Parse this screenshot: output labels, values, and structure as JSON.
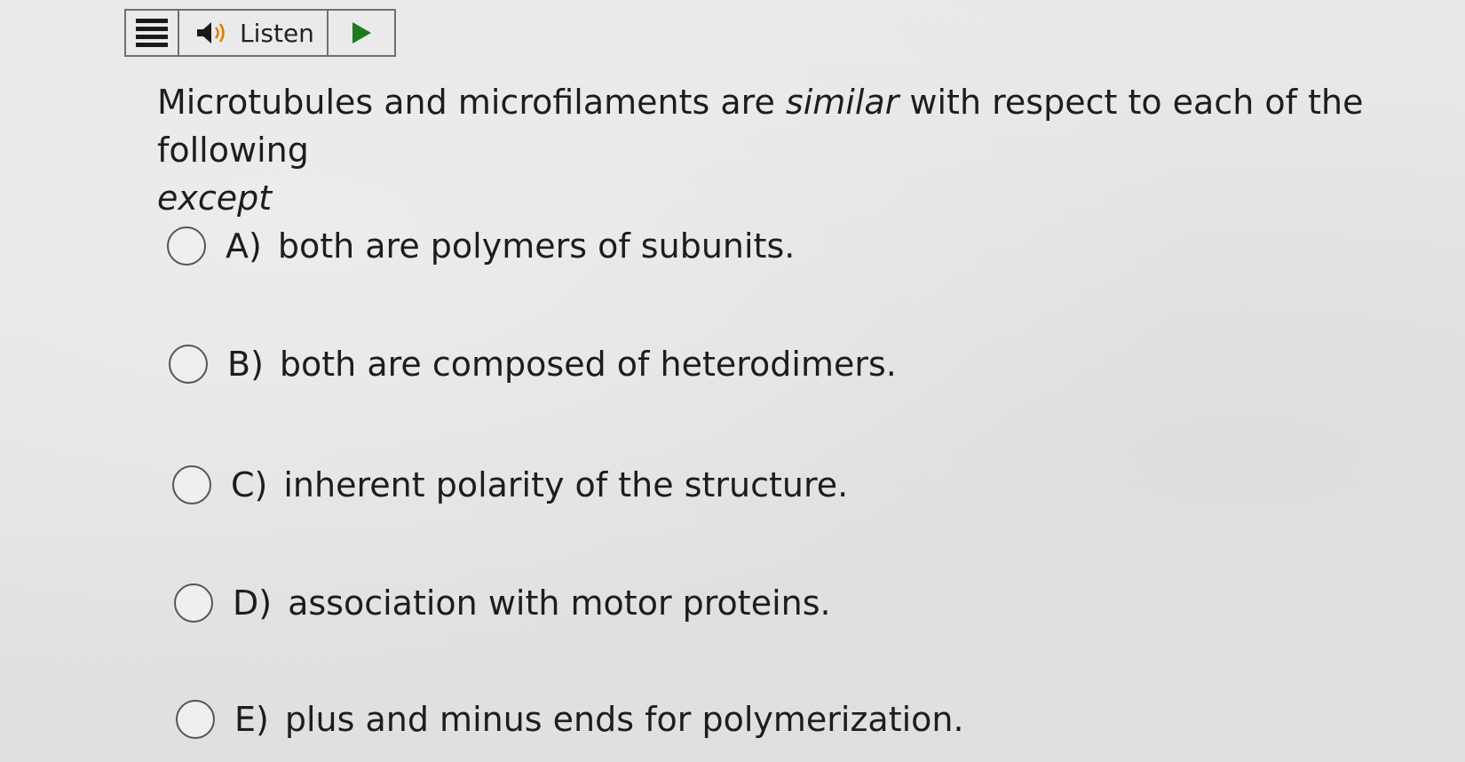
{
  "toolbar": {
    "menu_icon": "hamburger-menu-icon",
    "speaker_icon": "speaker-icon",
    "listen_label": "Listen",
    "play_icon": "play-icon",
    "accent_color": "#1f7a1f"
  },
  "question": {
    "part1": "Microtubules and microfilaments are ",
    "emphasis1": "similar",
    "part2": " with respect to each of the following ",
    "emphasis2": "except"
  },
  "options": [
    {
      "letter": "A)",
      "text": "both are polymers of subunits."
    },
    {
      "letter": "B)",
      "text": "both are composed of heterodimers."
    },
    {
      "letter": "C)",
      "text": "inherent polarity of the structure."
    },
    {
      "letter": "D)",
      "text": "association with motor proteins."
    },
    {
      "letter": "E)",
      "text": "plus and minus ends for polymerization."
    }
  ]
}
